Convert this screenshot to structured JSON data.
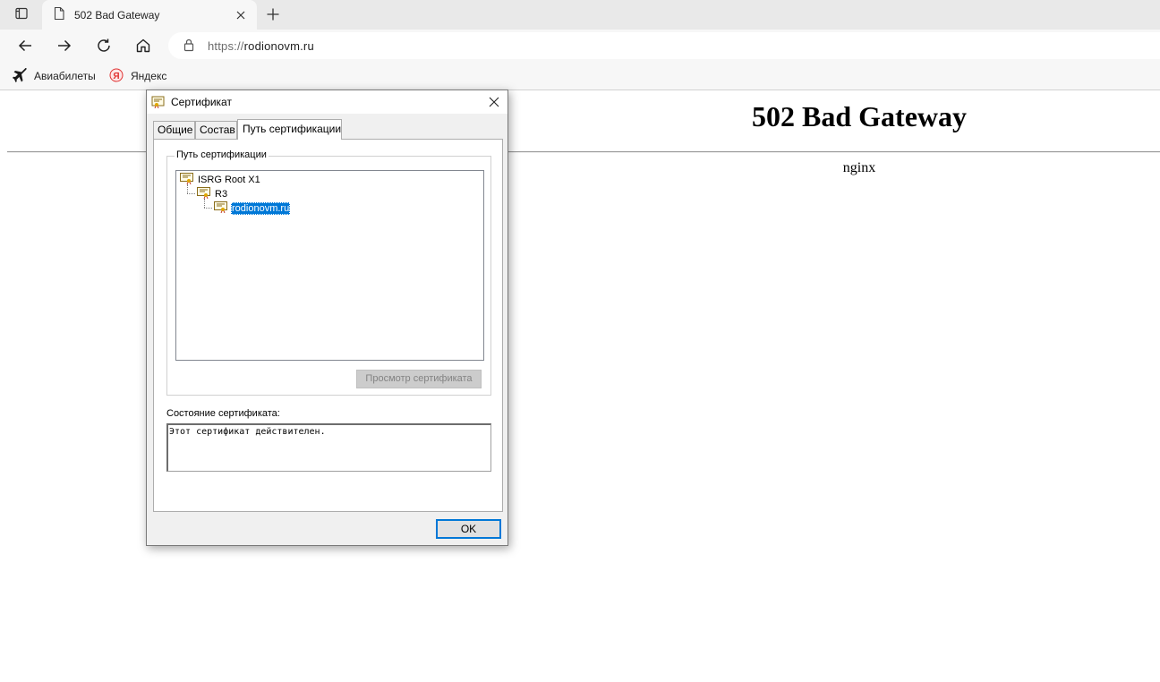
{
  "browser": {
    "tab": {
      "title": "502 Bad Gateway"
    },
    "address": {
      "scheme": "https://",
      "host": "rodionovm.ru"
    },
    "favorites": [
      {
        "label": "Авиабилеты",
        "icon": "airplane-icon"
      },
      {
        "label": "Яндекс",
        "icon": "yandex-icon"
      }
    ]
  },
  "page": {
    "heading": "502 Bad Gateway",
    "server": "nginx"
  },
  "dialog": {
    "title": "Сертификат",
    "tabs": [
      "Общие",
      "Состав",
      "Путь сертификации"
    ],
    "active_tab": 2,
    "path_group_label": "Путь сертификации",
    "tree": [
      {
        "label": "ISRG Root X1",
        "level": 0,
        "selected": false
      },
      {
        "label": "R3",
        "level": 1,
        "selected": false
      },
      {
        "label": "rodionovm.ru",
        "level": 2,
        "selected": true
      }
    ],
    "view_certificate_button": "Просмотр сертификата",
    "status_label": "Состояние сертификата:",
    "status_text": "Этот сертификат действителен.",
    "ok_button": "OK"
  },
  "colors": {
    "selection": "#0078d7",
    "tabstrip": "#e9e9e9",
    "toolbar": "#f7f7f7"
  }
}
